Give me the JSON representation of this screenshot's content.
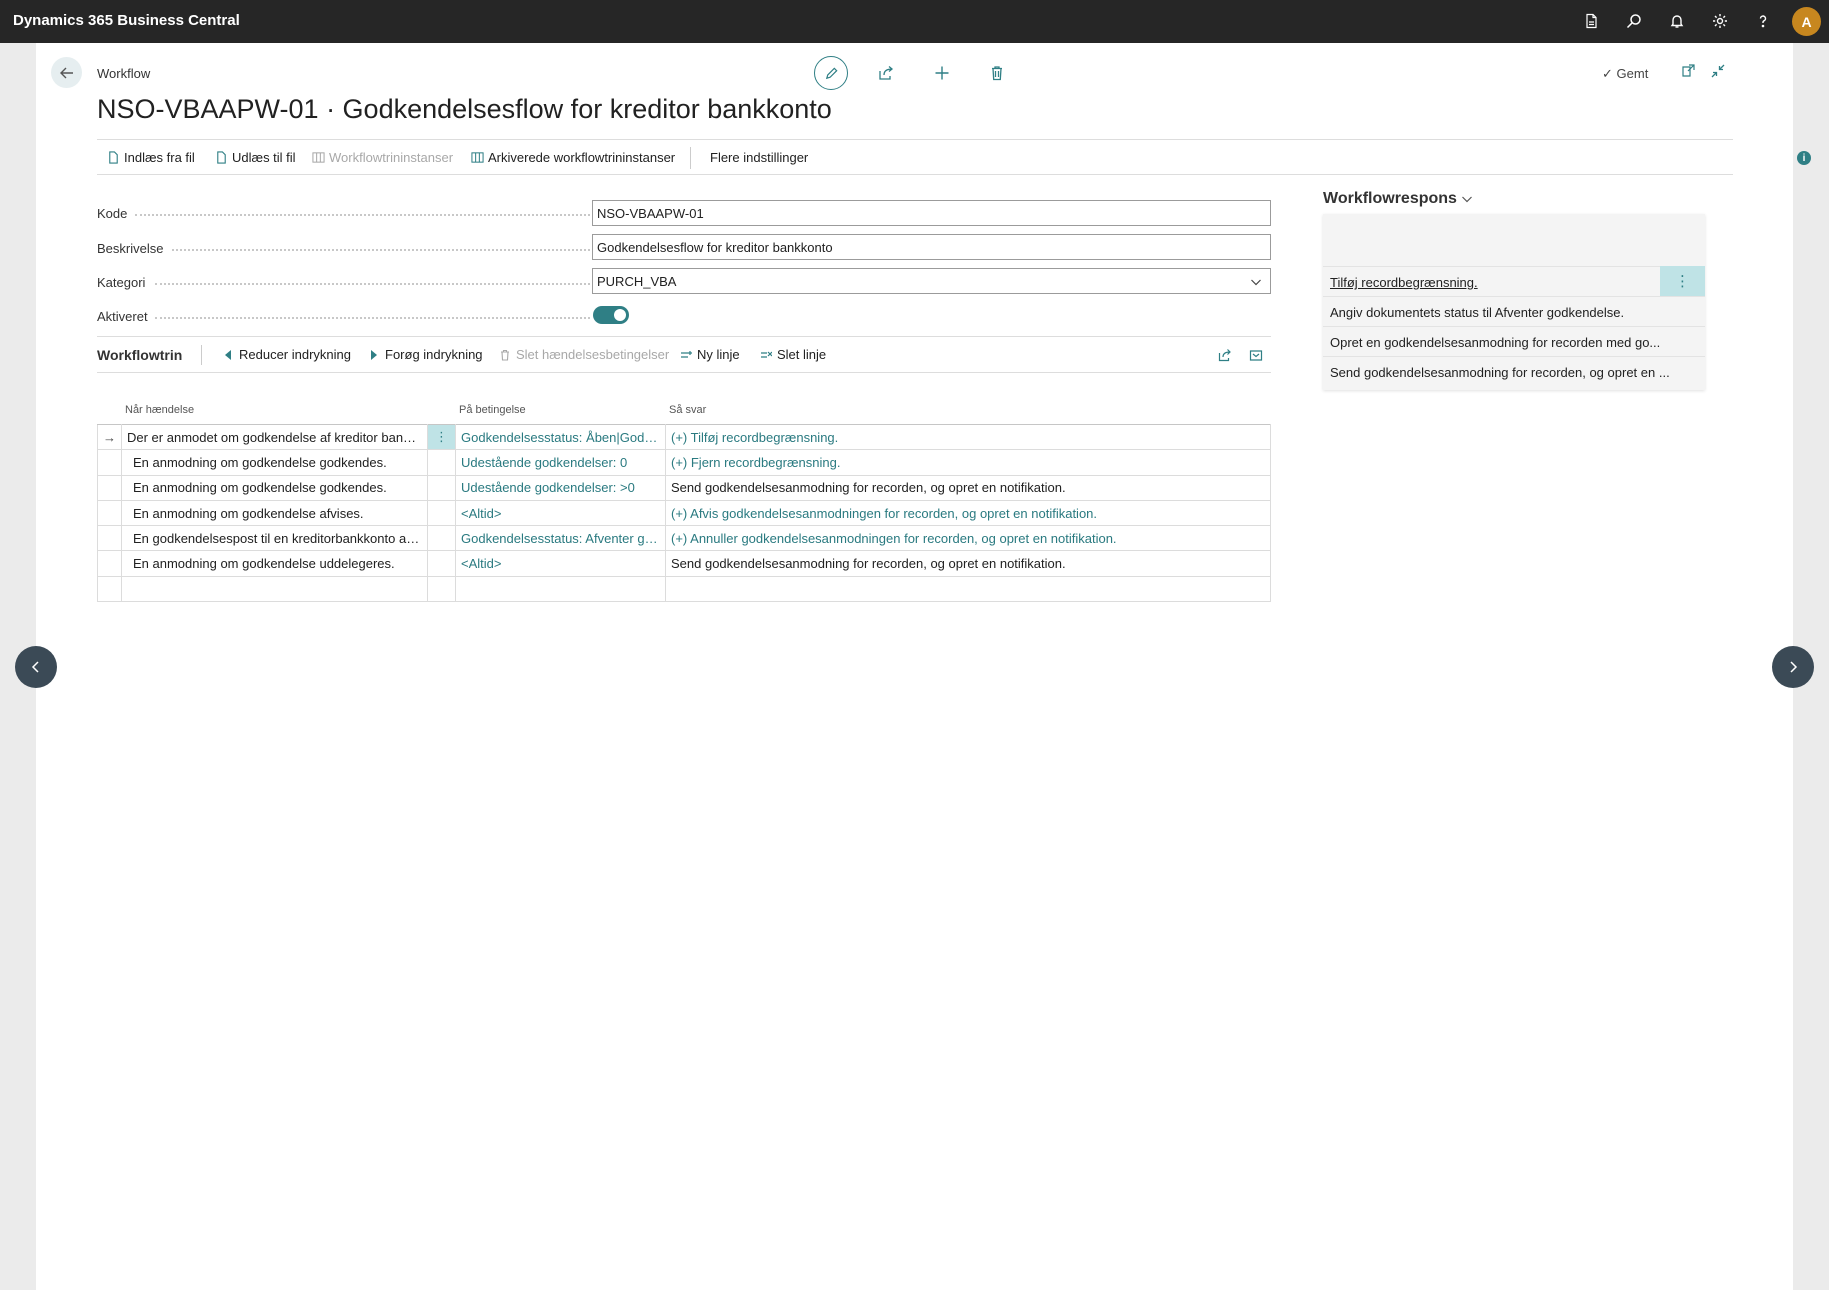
{
  "app": {
    "name": "Dynamics 365 Business Central",
    "user_initial": "A"
  },
  "top_icons": [
    "document-icon",
    "search-icon",
    "bell-icon",
    "gear-icon",
    "help-icon"
  ],
  "page": {
    "breadcrumb": "Workflow",
    "title": "NSO-VBAAPW-01 · Godkendelsesflow for kreditor bankkonto",
    "saved_label": "Gemt"
  },
  "actions": {
    "import": "Indlæs fra fil",
    "export": "Udlæs til fil",
    "step_instances": "Workflowtrininstanser",
    "archived": "Arkiverede workflowtrininstanser",
    "more": "Flere indstillinger"
  },
  "fields": {
    "kode_label": "Kode",
    "kode_value": "NSO-VBAAPW-01",
    "beskrivelse_label": "Beskrivelse",
    "beskrivelse_value": "Godkendelsesflow for kreditor bankkonto",
    "kategori_label": "Kategori",
    "kategori_value": "PURCH_VBA",
    "aktiveret_label": "Aktiveret",
    "aktiveret_value": true
  },
  "steps": {
    "title": "Workflowtrin",
    "decrease_indent": "Reducer indrykning",
    "increase_indent": "Forøg indrykning",
    "delete_conditions": "Slet hændelsesbetingelser",
    "new_line": "Ny linje",
    "delete_line": "Slet linje",
    "headers": {
      "event": "Når hændelse",
      "condition": "På betingelse",
      "response": "Så svar"
    },
    "rows": [
      {
        "event": "Der er anmodet om godkendelse af kreditor bankkonto.",
        "condition": "Godkendelsesstatus: Åben|Godkendt",
        "response": "(+) Tilføj recordbegrænsning.",
        "response_link": true
      },
      {
        "event": "En anmodning om godkendelse godkendes.",
        "condition": "Udestående godkendelser: 0",
        "response": "(+) Fjern recordbegrænsning.",
        "response_link": true
      },
      {
        "event": "En anmodning om godkendelse godkendes.",
        "condition": "Udestående godkendelser: >0",
        "response": "Send godkendelsesanmodning for recorden, og opret en notifikation.",
        "response_link": false
      },
      {
        "event": "En anmodning om godkendelse afvises.",
        "condition": "<Altid>",
        "response": "(+) Afvis godkendelsesanmodningen for recorden, og opret en notifikation.",
        "response_link": true
      },
      {
        "event": "En godkendelsespost til en kreditorbankkonto annulleres.",
        "condition": "Godkendelsesstatus: Afventer godkendelse",
        "response": "(+) Annuller godkendelsesanmodningen for recorden, og opret en notifikation.",
        "response_link": true
      },
      {
        "event": "En anmodning om godkendelse uddelegeres.",
        "condition": "<Altid>",
        "response": "Send godkendelsesanmodning for recorden, og opret en notifikation.",
        "response_link": false
      },
      {
        "event": "",
        "condition": "",
        "response": "",
        "response_link": false
      }
    ]
  },
  "side": {
    "title": "Workflowrespons",
    "items": [
      "Tilføj recordbegrænsning.",
      "Angiv dokumentets status til Afventer godkendelse.",
      "Opret en godkendelsesanmodning for recorden med go...",
      "Send godkendelsesanmodning for recorden, og opret en ..."
    ]
  },
  "colors": {
    "accent": "#2f7f85",
    "topbar": "#262626",
    "avatar": "#c7871f"
  }
}
